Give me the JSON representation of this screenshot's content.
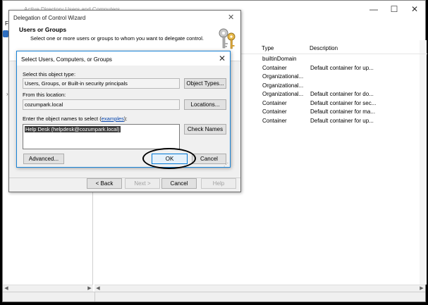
{
  "background_window": {
    "title": "Active Directory Users and Computers",
    "menu_first_letter": "F",
    "columns": {
      "type": "Type",
      "description": "Description"
    },
    "rows": [
      {
        "type": "builtinDomain",
        "description": ""
      },
      {
        "type": "Container",
        "description": "Default container for up..."
      },
      {
        "type": "Organizational...",
        "description": ""
      },
      {
        "type": "Organizational...",
        "description": ""
      },
      {
        "type": "Organizational...",
        "description": "Default container for do..."
      },
      {
        "type": "Container",
        "description": "Default container for sec..."
      },
      {
        "type": "Container",
        "description": "Default container for ma..."
      },
      {
        "type": "Container",
        "description": "Default container for up..."
      }
    ]
  },
  "wizard": {
    "title": "Delegation of Control Wizard",
    "heading": "Users or Groups",
    "subheading": "Select one or more users or groups to whom you want to delegate control.",
    "buttons": {
      "back": "< Back",
      "next": "Next >",
      "cancel": "Cancel",
      "help": "Help"
    }
  },
  "select_dialog": {
    "title": "Select Users, Computers, or Groups",
    "object_type_label": "Select this object type:",
    "object_type_value": "Users, Groups, or Built-in security principals",
    "object_types_button": "Object Types...",
    "location_label": "From this location:",
    "location_value": "cozumpark.local",
    "locations_button": "Locations...",
    "names_label_prefix": "Enter the object names to select (",
    "names_label_link": "examples",
    "names_label_suffix": "):",
    "names_value": "Help Desk (helpdesk@cozumpark.local)",
    "check_names_button": "Check Names",
    "advanced_button": "Advanced...",
    "ok_button": "OK",
    "cancel_button": "Cancel"
  },
  "icons": [
    "close-icon",
    "minimize-icon",
    "maximize-icon",
    "keys-icon",
    "resize-grip-icon"
  ],
  "colors": {
    "accent": "#0078d7",
    "dialog_border": "#1883d7",
    "selection": "#3c3c3c"
  }
}
